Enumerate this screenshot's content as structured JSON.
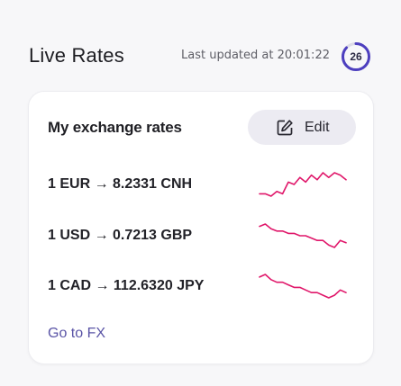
{
  "header": {
    "title": "Live Rates",
    "last_updated": "Last updated at 20:01:22",
    "countdown": "26",
    "countdown_progress": 0.87
  },
  "card": {
    "title": "My exchange rates",
    "edit_label": "Edit",
    "rates": [
      {
        "text": "1 EUR → 8.2331 CNH",
        "sparkline": [
          10,
          10,
          11,
          9,
          10,
          5,
          6,
          3,
          5,
          2,
          4,
          1,
          3,
          1,
          2,
          4
        ]
      },
      {
        "text": "1 USD → 0.7213 GBP",
        "sparkline": [
          2,
          1,
          3,
          4,
          4,
          5,
          5,
          6,
          6,
          7,
          8,
          8,
          10,
          11,
          8,
          9
        ]
      },
      {
        "text": "1 CAD → 112.6320 JPY",
        "sparkline": [
          2,
          1,
          3,
          4,
          4,
          5,
          6,
          6,
          7,
          8,
          8,
          9,
          10,
          9,
          7,
          8
        ]
      }
    ],
    "link_label": "Go to FX"
  },
  "colors": {
    "sparkline": "#e0176a",
    "link": "#5a54a6",
    "ring": "#4d3fbf",
    "ring_track": "#dcdbe8"
  }
}
